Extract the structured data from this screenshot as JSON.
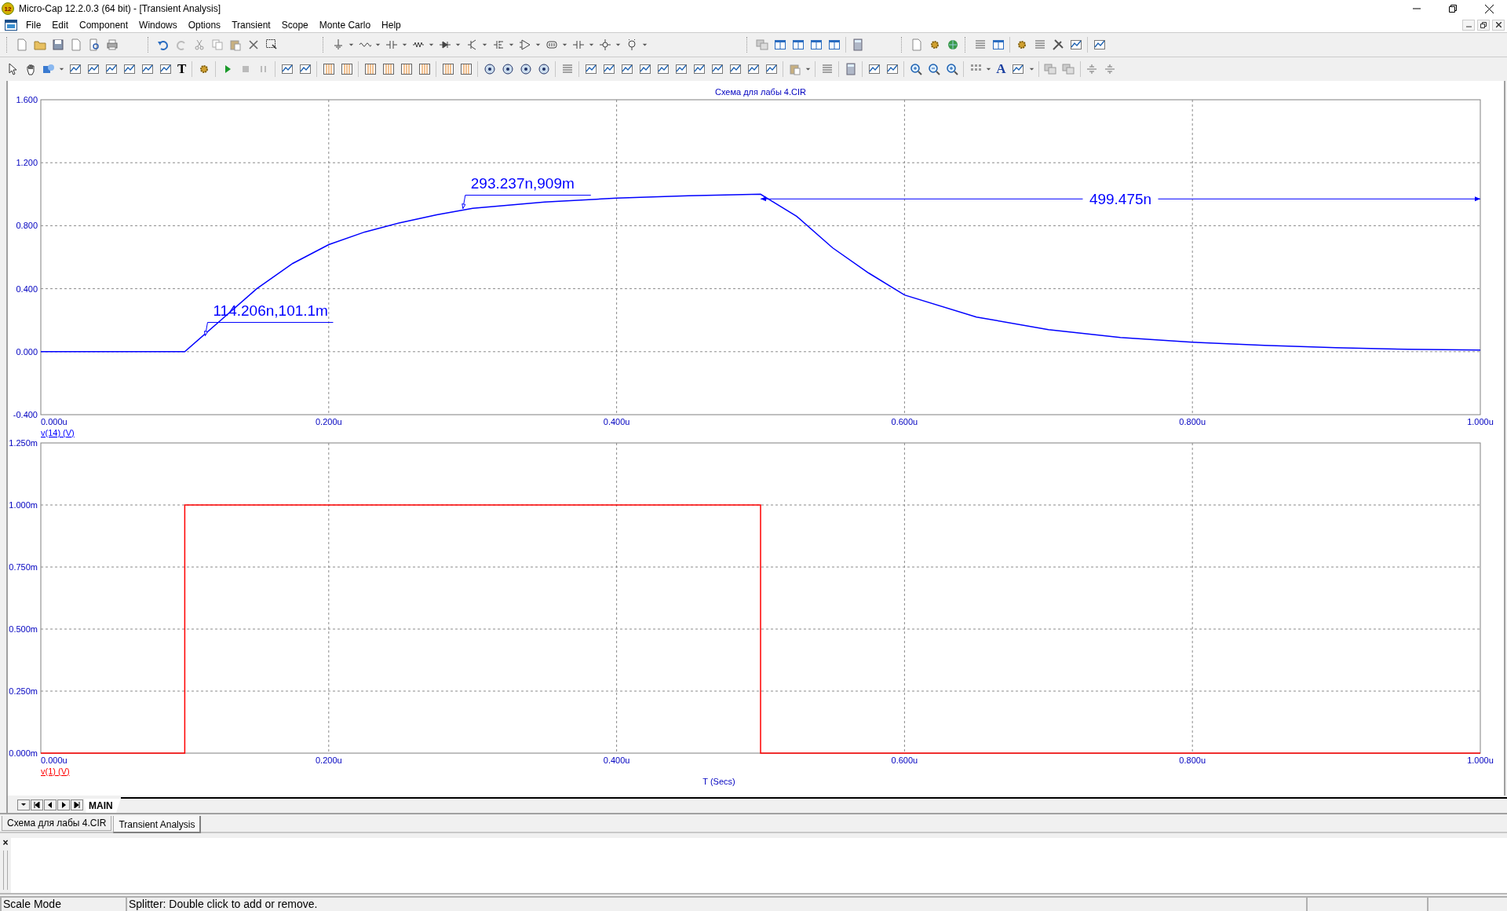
{
  "window": {
    "app_badge": "12",
    "title": "Micro-Cap 12.2.0.3 (64 bit) - [Transient Analysis]"
  },
  "menu": [
    "File",
    "Edit",
    "Component",
    "Windows",
    "Options",
    "Transient",
    "Scope",
    "Monte Carlo",
    "Help"
  ],
  "toolbar2": {
    "text_tool": "T",
    "font_tool": "A"
  },
  "charts": [
    {
      "chart_data": {
        "type": "line",
        "title": "Схема для лабы 4.CIR",
        "x": [
          0,
          0.05,
          0.1,
          0.125,
          0.15,
          0.175,
          0.2,
          0.225,
          0.25,
          0.275,
          0.3,
          0.35,
          0.4,
          0.45,
          0.5,
          0.525,
          0.55,
          0.575,
          0.6,
          0.65,
          0.7,
          0.75,
          0.8,
          0.85,
          0.9,
          0.95,
          1.0
        ],
        "series": [
          {
            "name": "v(14) (V)",
            "color": "#0000ff",
            "values": [
              0,
              0,
              0,
              0.2,
              0.4,
              0.56,
              0.68,
              0.76,
              0.82,
              0.87,
              0.91,
              0.95,
              0.975,
              0.99,
              1.0,
              0.86,
              0.66,
              0.5,
              0.36,
              0.22,
              0.14,
              0.09,
              0.06,
              0.04,
              0.025,
              0.015,
              0.01
            ]
          }
        ],
        "xlim": [
          0,
          1
        ],
        "ylim": [
          -0.4,
          1.6
        ],
        "xticks": [
          {
            "value": 0,
            "label": "0.000u"
          },
          {
            "value": 0.2,
            "label": "0.200u"
          },
          {
            "value": 0.4,
            "label": "0.400u"
          },
          {
            "value": 0.6,
            "label": "0.600u"
          },
          {
            "value": 0.8,
            "label": "0.800u"
          },
          {
            "value": 1.0,
            "label": "1.000u"
          }
        ],
        "yticks": [
          {
            "value": -0.4,
            "label": "-0.400"
          },
          {
            "value": 0,
            "label": "0.000"
          },
          {
            "value": 0.4,
            "label": "0.400"
          },
          {
            "value": 0.8,
            "label": "0.800"
          },
          {
            "value": 1.2,
            "label": "1.200"
          },
          {
            "value": 1.6,
            "label": "1.600"
          }
        ],
        "annotations": [
          {
            "text": "114.206n,101.1m",
            "x": 0.114206,
            "y": 0.1011
          },
          {
            "text": "293.237n,909m",
            "x": 0.293237,
            "y": 0.909
          },
          "499.475n"
        ],
        "grid": true
      }
    },
    {
      "chart_data": {
        "type": "line",
        "xlabel": "T (Secs)",
        "x": [
          0,
          0.1,
          0.1,
          0.5,
          0.5,
          1.0
        ],
        "series": [
          {
            "name": "v(1) (V)",
            "color": "#ff0000",
            "values": [
              0,
              0,
              1,
              1,
              0,
              0
            ]
          }
        ],
        "xlim": [
          0,
          1
        ],
        "ylim": [
          0,
          1.25
        ],
        "xticks": [
          {
            "value": 0,
            "label": "0.000u"
          },
          {
            "value": 0.2,
            "label": "0.200u"
          },
          {
            "value": 0.4,
            "label": "0.400u"
          },
          {
            "value": 0.6,
            "label": "0.600u"
          },
          {
            "value": 0.8,
            "label": "0.800u"
          },
          {
            "value": 1.0,
            "label": "1.000u"
          }
        ],
        "yticks": [
          {
            "value": 0,
            "label": "0.000m"
          },
          {
            "value": 0.25,
            "label": "0.250m"
          },
          {
            "value": 0.5,
            "label": "0.500m"
          },
          {
            "value": 0.75,
            "label": "0.750m"
          },
          {
            "value": 1.0,
            "label": "1.000m"
          },
          {
            "value": 1.25,
            "label": "1.250m"
          }
        ],
        "grid": true
      }
    }
  ],
  "page_tabs": [
    {
      "label": "MAIN",
      "selected": true
    }
  ],
  "document_tabs": [
    {
      "label": "Схема для лабы 4.CIR",
      "selected": false
    },
    {
      "label": "Transient Analysis",
      "selected": true
    }
  ],
  "output_pane": {
    "close": "×"
  },
  "status_bar": [
    "Scale Mode",
    "Splitter: Double click to add or remove."
  ]
}
